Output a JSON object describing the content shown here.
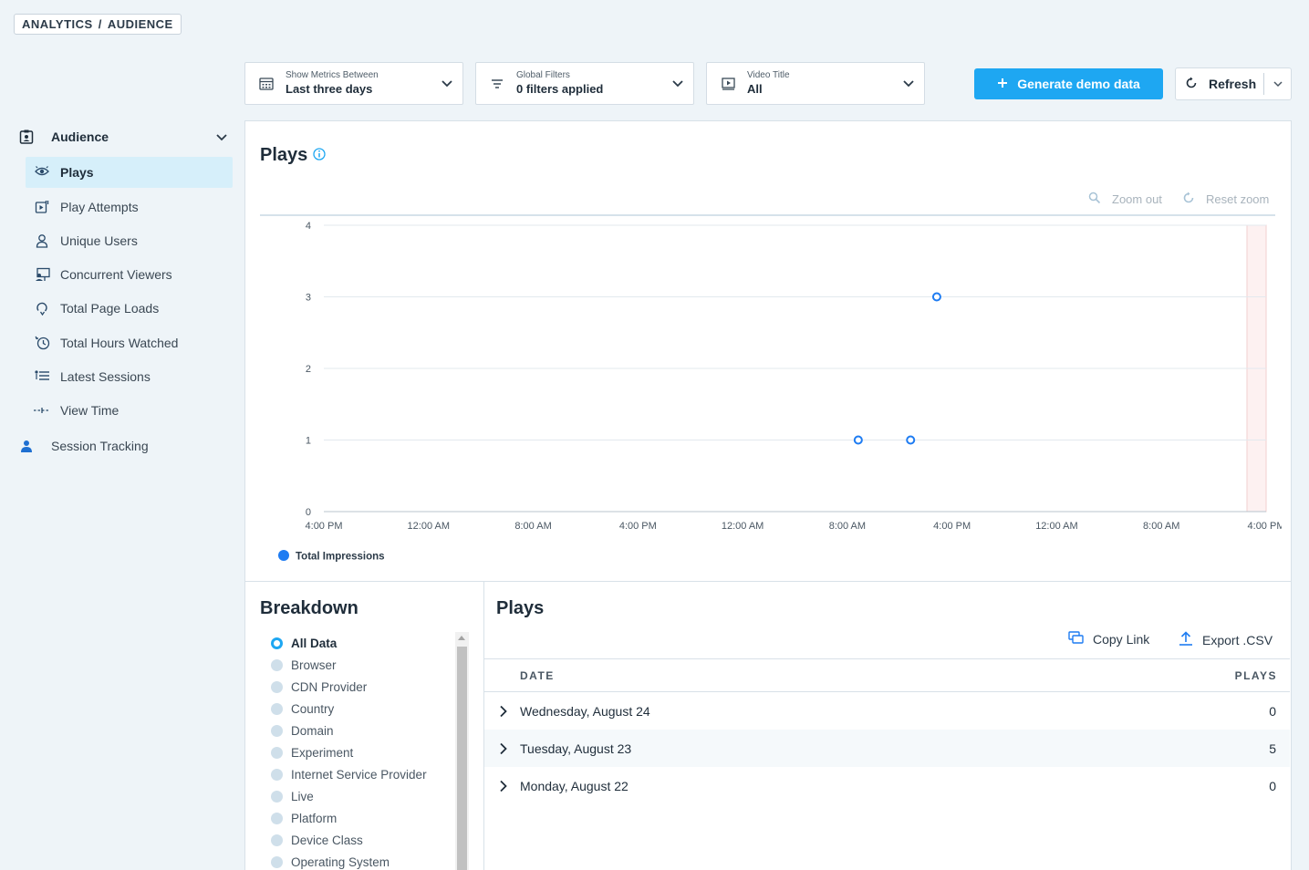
{
  "breadcrumb": [
    "ANALYTICS",
    "/",
    "AUDIENCE"
  ],
  "filters": {
    "metrics": {
      "label": "Show Metrics Between",
      "value": "Last three days",
      "icon": "calendar-icon"
    },
    "global": {
      "label": "Global Filters",
      "value": "0 filters applied",
      "icon": "filter-icon"
    },
    "video": {
      "label": "Video Title",
      "value": "All",
      "icon": "video-icon"
    }
  },
  "actions": {
    "generate_label": "Generate demo data",
    "refresh_label": "Refresh"
  },
  "sidebar": {
    "audience_label": "Audience",
    "items": [
      {
        "label": "Plays",
        "icon": "eye-icon",
        "active": true
      },
      {
        "label": "Play Attempts",
        "icon": "play-attempts-icon"
      },
      {
        "label": "Unique Users",
        "icon": "user-icon"
      },
      {
        "label": "Concurrent Viewers",
        "icon": "concurrent-viewers-icon"
      },
      {
        "label": "Total Page Loads",
        "icon": "page-loads-icon"
      },
      {
        "label": "Total Hours Watched",
        "icon": "clock-icon"
      },
      {
        "label": "Latest Sessions",
        "icon": "list-icon"
      },
      {
        "label": "View Time",
        "icon": "view-time-icon"
      }
    ],
    "session_tracking_label": "Session Tracking"
  },
  "chart_panel": {
    "title": "Plays",
    "zoom_out": "Zoom out",
    "reset_zoom": "Reset zoom"
  },
  "chart_data": {
    "type": "scatter",
    "yticks": [
      0,
      1,
      2,
      3,
      4
    ],
    "ylim": [
      0,
      4
    ],
    "xticks": [
      "4:00 PM",
      "12:00 AM",
      "8:00 AM",
      "4:00 PM",
      "12:00 AM",
      "8:00 AM",
      "4:00 PM",
      "12:00 AM",
      "8:00 AM",
      "4:00 PM"
    ],
    "xlim": [
      "4:00 PM",
      "4:00 PM"
    ],
    "series": [
      {
        "name": "Total Impressions",
        "color": "#1e7cf2",
        "points": [
          {
            "x": "8:50 AM",
            "y": 1
          },
          {
            "x": "12:50 PM",
            "y": 1
          },
          {
            "x": "2:50 PM",
            "y": 3
          }
        ]
      }
    ],
    "legend": "bottom-left",
    "grid": true
  },
  "breakdown": {
    "title": "Breakdown",
    "options": [
      "All Data",
      "Browser",
      "CDN Provider",
      "Country",
      "Domain",
      "Experiment",
      "Internet Service Provider",
      "Live",
      "Platform",
      "Device Class",
      "Operating System"
    ],
    "selected": "All Data"
  },
  "table": {
    "title": "Plays",
    "copy_link": "Copy Link",
    "export_csv": "Export .CSV",
    "columns": [
      "DATE",
      "PLAYS"
    ],
    "rows": [
      {
        "date": "Wednesday, August 24",
        "plays": "0"
      },
      {
        "date": "Tuesday, August 23",
        "plays": "5"
      },
      {
        "date": "Monday, August 22",
        "plays": "0"
      }
    ]
  }
}
